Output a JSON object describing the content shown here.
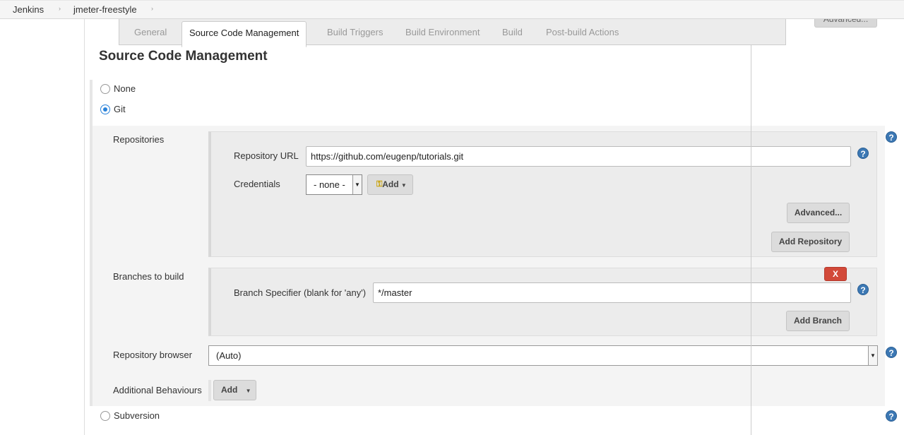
{
  "breadcrumb": {
    "items": [
      "Jenkins",
      "jmeter-freestyle"
    ],
    "sep": "›"
  },
  "tabs": {
    "general": "General",
    "scm": "Source Code Management",
    "triggers": "Build Triggers",
    "environment": "Build Environment",
    "build": "Build",
    "post_build": "Post-build Actions"
  },
  "top_advanced_label": "Advanced...",
  "section_title": "Source Code Management",
  "scm_options": {
    "none": "None",
    "git": "Git",
    "subversion": "Subversion",
    "selected": "git"
  },
  "repositories": {
    "label": "Repositories",
    "url_label": "Repository URL",
    "url_value": "https://github.com/eugenp/tutorials.git",
    "credentials_label": "Credentials",
    "credentials_value": "- none -",
    "add_label": "Add",
    "advanced_label": "Advanced...",
    "add_repository_label": "Add Repository"
  },
  "branches": {
    "label": "Branches to build",
    "delete_label": "X",
    "specifier_label": "Branch Specifier (blank for 'any')",
    "specifier_value": "*/master",
    "add_branch_label": "Add Branch"
  },
  "repo_browser": {
    "label": "Repository browser",
    "value": "(Auto)"
  },
  "additional_behaviours": {
    "label": "Additional Behaviours",
    "add_label": "Add"
  },
  "help_glyph": "?",
  "colors": {
    "accent": "#2a82da",
    "help": "#3c78b4",
    "danger": "#d24939"
  }
}
